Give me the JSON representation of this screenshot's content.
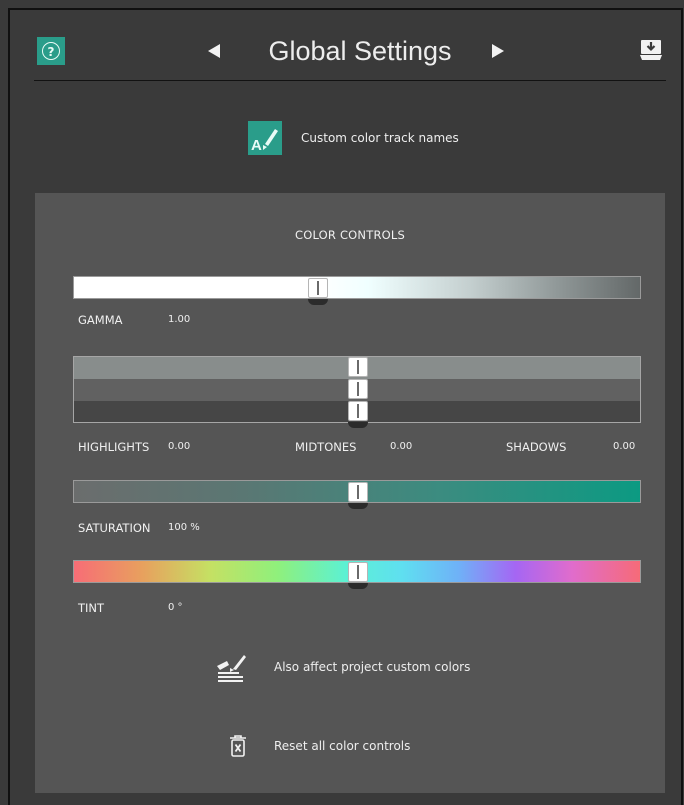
{
  "header": {
    "title": "Global Settings",
    "help_icon": "question-circle-icon",
    "prev_icon": "triangle-left-icon",
    "next_icon": "triangle-right-icon",
    "download_icon": "download-tray-icon"
  },
  "custom_color": {
    "icon": "font-color-brush-icon",
    "icon_letter": "A",
    "label": "Custom color track names"
  },
  "color_controls": {
    "title": "COLOR CONTROLS",
    "gamma": {
      "label": "GAMMA",
      "value": "1.00",
      "level": 0.43
    },
    "levels": {
      "highlights": {
        "label": "HIGHLIGHTS",
        "value": "0.00",
        "level": 0.5
      },
      "midtones": {
        "label": "MIDTONES",
        "value": "0.00",
        "level": 0.5
      },
      "shadows": {
        "label": "SHADOWS",
        "value": "0.00",
        "level": 0.5
      }
    },
    "saturation": {
      "label": "SATURATION",
      "value": "100 %",
      "level": 0.5
    },
    "tint": {
      "label": "TINT",
      "value": "0 °",
      "level": 0.5
    }
  },
  "actions": {
    "affect_project": {
      "label": "Also affect project custom colors",
      "icon": "paint-brush-swatches-icon"
    },
    "reset": {
      "label": "Reset all color controls",
      "icon": "trash-x-icon"
    }
  },
  "colors": {
    "accent": "#2a9d8a",
    "panel_bg": "#555555",
    "window_bg": "#3a3a3a"
  }
}
